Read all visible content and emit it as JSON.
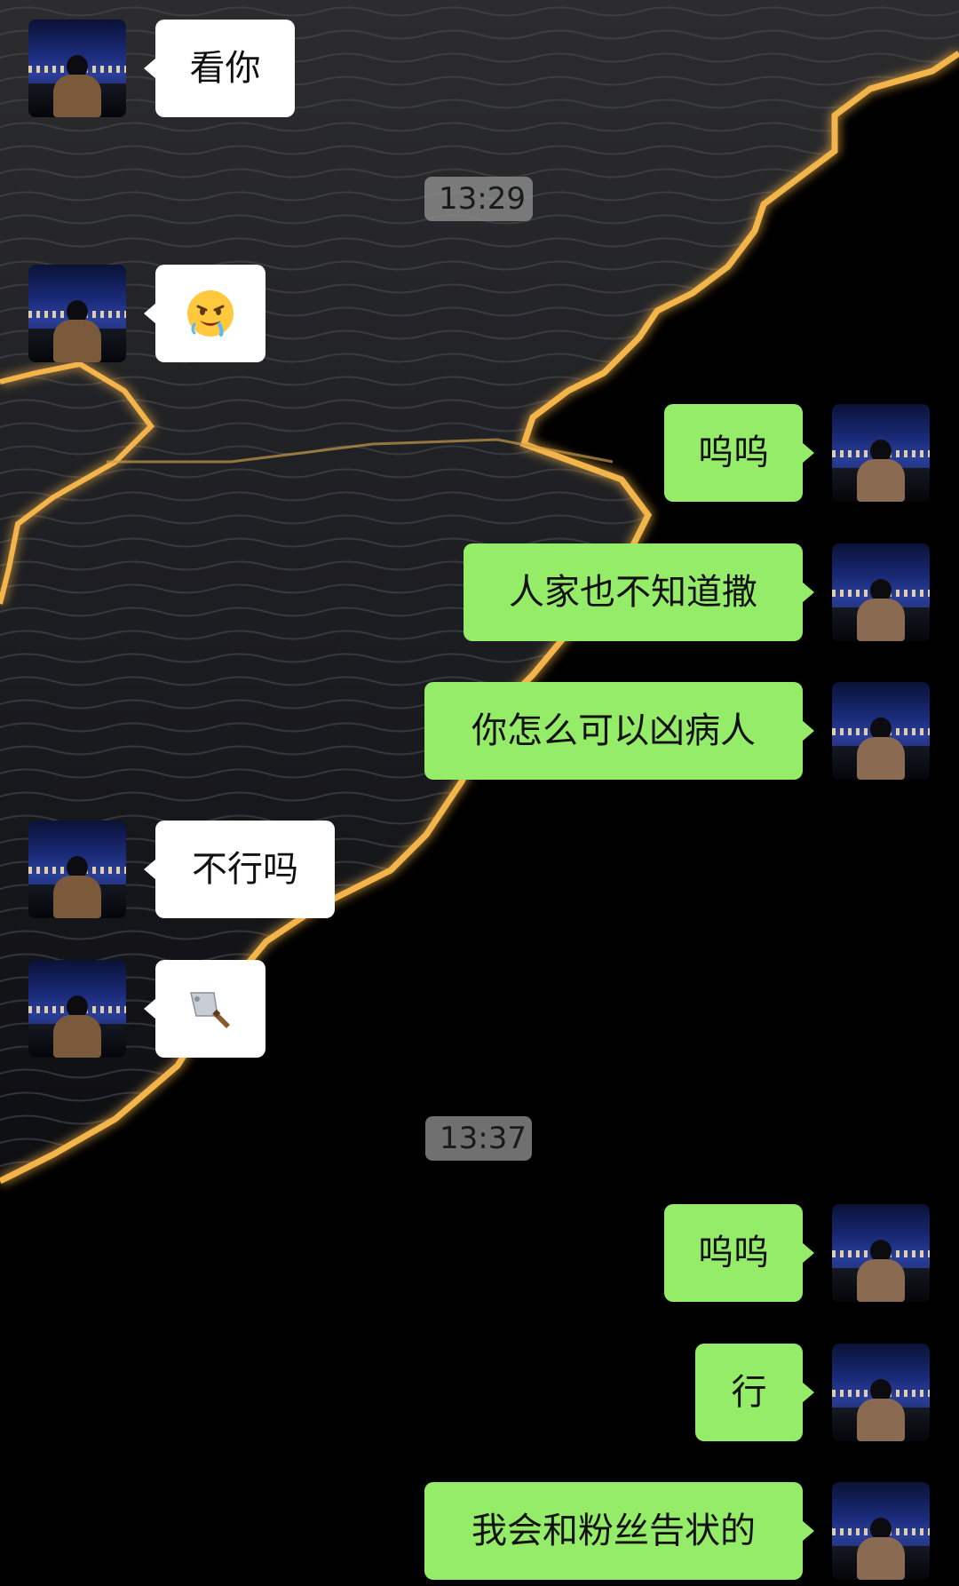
{
  "theme": {
    "incoming_bubble_color": "#ffffff",
    "outgoing_bubble_color": "#95ec69",
    "timestamp_bg": "#969696",
    "background_glow": "#f3b44a"
  },
  "messages": [
    {
      "side": "in",
      "kind": "text",
      "text": "看你"
    },
    {
      "kind": "timestamp",
      "text": "13:29"
    },
    {
      "side": "in",
      "kind": "emoji",
      "emoji": "drooling-face-emoji"
    },
    {
      "side": "out",
      "kind": "text",
      "text": "呜呜"
    },
    {
      "side": "out",
      "kind": "text",
      "text": "人家也不知道撒"
    },
    {
      "side": "out",
      "kind": "text",
      "text": "你怎么可以凶病人"
    },
    {
      "side": "in",
      "kind": "text",
      "text": "不行吗"
    },
    {
      "side": "in",
      "kind": "emoji",
      "emoji": "cleaver-knife-emoji"
    },
    {
      "kind": "timestamp",
      "text": "13:37"
    },
    {
      "side": "out",
      "kind": "text",
      "text": "呜呜"
    },
    {
      "side": "out",
      "kind": "text",
      "text": "行"
    },
    {
      "side": "out",
      "kind": "text",
      "text": "我会和粉丝告状的"
    }
  ]
}
